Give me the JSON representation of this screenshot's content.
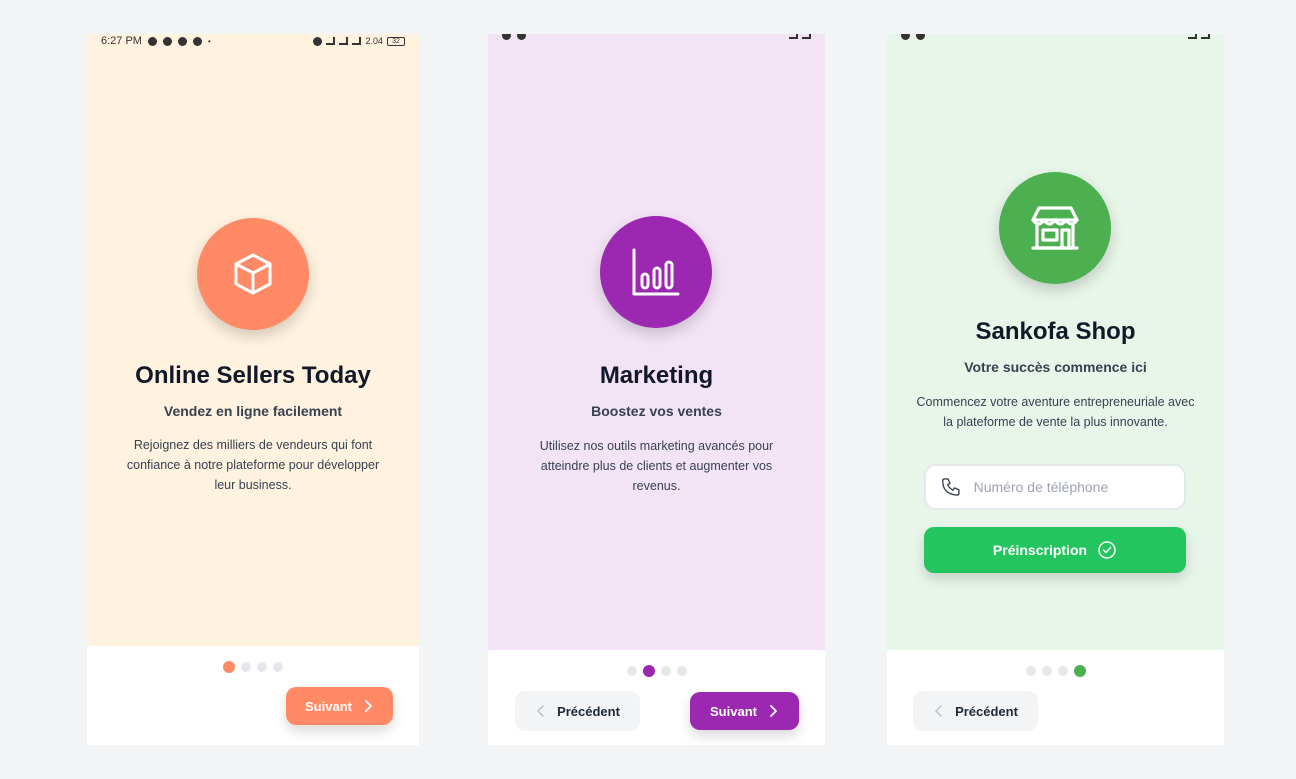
{
  "screens": [
    {
      "status_time": "6:27 PM",
      "status_speed": "2.04",
      "status_battery": "32",
      "title": "Online Sellers Today",
      "subtitle": "Vendez en ligne facilement",
      "description": "Rejoignez des milliers de vendeurs qui font confiance à notre plateforme pour développer leur business.",
      "icon": "cube-icon",
      "accent": "#ff8a65",
      "background": "#fff2df",
      "active_dot": 0,
      "next_label": "Suivant"
    },
    {
      "title": "Marketing",
      "subtitle": "Boostez vos ventes",
      "description": "Utilisez nos outils marketing avancés pour atteindre plus de clients et augmenter vos revenus.",
      "icon": "bar-chart-icon",
      "accent": "#9c27b0",
      "background": "#f3e4f5",
      "active_dot": 1,
      "prev_label": "Précédent",
      "next_label": "Suivant"
    },
    {
      "title": "Sankofa Shop",
      "subtitle": "Votre succès commence ici",
      "description": "Commencez votre aventure entrepreneuriale avec la plateforme de vente la plus innovante.",
      "icon": "storefront-icon",
      "accent": "#4caf50",
      "background": "#e8f5e9",
      "active_dot": 3,
      "phone_placeholder": "Numéro de téléphone",
      "register_label": "Préinscription",
      "register_color": "#22c55e",
      "prev_label": "Précédent"
    }
  ]
}
